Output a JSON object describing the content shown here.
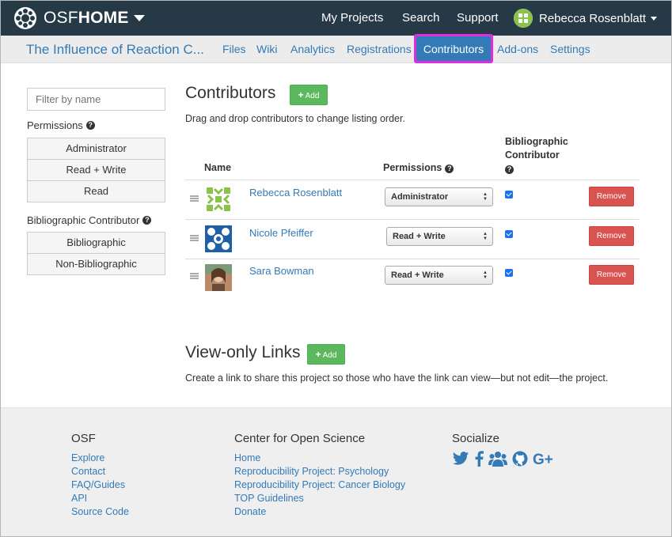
{
  "navbar": {
    "brand_osf": "OSF",
    "brand_home": "HOME",
    "links": [
      "My Projects",
      "Search",
      "Support"
    ],
    "user_name": "Rebecca Rosenblatt"
  },
  "subnav": {
    "project_title": "The Influence of Reaction C...",
    "tabs": [
      "Files",
      "Wiki",
      "Analytics",
      "Registrations",
      "Contributors",
      "Add-ons",
      "Settings"
    ],
    "active_tab": "Contributors"
  },
  "sidebar": {
    "filter_placeholder": "Filter by name",
    "permissions_label": "Permissions",
    "permissions_options": [
      "Administrator",
      "Read + Write",
      "Read"
    ],
    "bibliographic_label": "Bibliographic Contributor",
    "bibliographic_options": [
      "Bibliographic",
      "Non-Bibliographic"
    ]
  },
  "contributors": {
    "title": "Contributors",
    "add_label": "Add",
    "help": "Drag and drop contributors to change listing order.",
    "headers": {
      "name": "Name",
      "permissions": "Permissions",
      "bibliographic_line1": "Bibliographic",
      "bibliographic_line2": "Contributor"
    },
    "rows": [
      {
        "name": "Rebecca Rosenblatt",
        "permission": "Administrator",
        "bibliographic": true,
        "remove": "Remove"
      },
      {
        "name": "Nicole Pfeiffer",
        "permission": "Read + Write",
        "bibliographic": true,
        "remove": "Remove"
      },
      {
        "name": "Sara Bowman",
        "permission": "Read + Write",
        "bibliographic": true,
        "remove": "Remove"
      }
    ]
  },
  "view_only": {
    "title": "View-only Links",
    "add_label": "Add",
    "help": "Create a link to share this project so those who have the link can view—but not edit—the project."
  },
  "footer": {
    "osf_heading": "OSF",
    "osf_links": [
      "Explore",
      "Contact",
      "FAQ/Guides",
      "API",
      "Source Code"
    ],
    "cos_heading": "Center for Open Science",
    "cos_links": [
      "Home",
      "Reproducibility Project: Psychology",
      "Reproducibility Project: Cancer Biology",
      "TOP Guidelines",
      "Donate"
    ],
    "social_heading": "Socialize",
    "social_icons": [
      "twitter-icon",
      "facebook-icon",
      "group-icon",
      "github-icon",
      "google-plus-icon"
    ],
    "social_glyphs": [
      "🐦",
      "f",
      "👥",
      "◉",
      "G+"
    ]
  },
  "colors": {
    "navbar": "#263947",
    "link": "#337ab7",
    "add": "#5cb85c",
    "remove": "#d9534f",
    "highlight": "#e12de1"
  }
}
